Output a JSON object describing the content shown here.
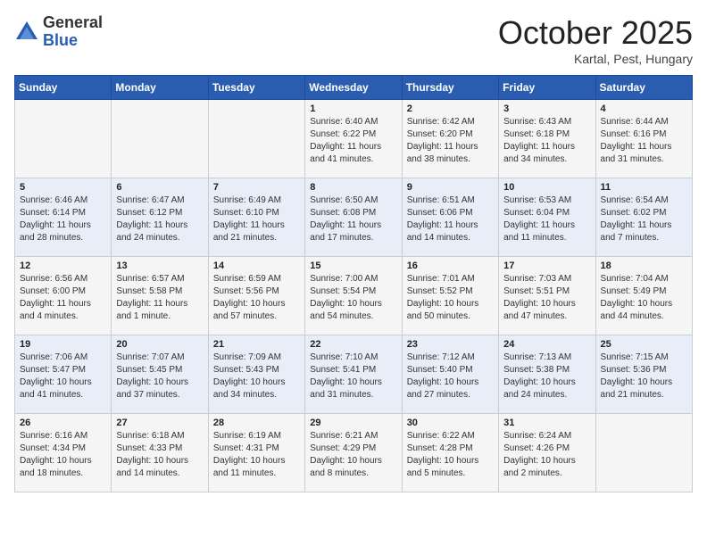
{
  "header": {
    "logo": {
      "general": "General",
      "blue": "Blue"
    },
    "title": "October 2025",
    "location": "Kartal, Pest, Hungary"
  },
  "days_of_week": [
    "Sunday",
    "Monday",
    "Tuesday",
    "Wednesday",
    "Thursday",
    "Friday",
    "Saturday"
  ],
  "weeks": [
    [
      {
        "day": "",
        "info": ""
      },
      {
        "day": "",
        "info": ""
      },
      {
        "day": "",
        "info": ""
      },
      {
        "day": "1",
        "info": "Sunrise: 6:40 AM\nSunset: 6:22 PM\nDaylight: 11 hours\nand 41 minutes."
      },
      {
        "day": "2",
        "info": "Sunrise: 6:42 AM\nSunset: 6:20 PM\nDaylight: 11 hours\nand 38 minutes."
      },
      {
        "day": "3",
        "info": "Sunrise: 6:43 AM\nSunset: 6:18 PM\nDaylight: 11 hours\nand 34 minutes."
      },
      {
        "day": "4",
        "info": "Sunrise: 6:44 AM\nSunset: 6:16 PM\nDaylight: 11 hours\nand 31 minutes."
      }
    ],
    [
      {
        "day": "5",
        "info": "Sunrise: 6:46 AM\nSunset: 6:14 PM\nDaylight: 11 hours\nand 28 minutes."
      },
      {
        "day": "6",
        "info": "Sunrise: 6:47 AM\nSunset: 6:12 PM\nDaylight: 11 hours\nand 24 minutes."
      },
      {
        "day": "7",
        "info": "Sunrise: 6:49 AM\nSunset: 6:10 PM\nDaylight: 11 hours\nand 21 minutes."
      },
      {
        "day": "8",
        "info": "Sunrise: 6:50 AM\nSunset: 6:08 PM\nDaylight: 11 hours\nand 17 minutes."
      },
      {
        "day": "9",
        "info": "Sunrise: 6:51 AM\nSunset: 6:06 PM\nDaylight: 11 hours\nand 14 minutes."
      },
      {
        "day": "10",
        "info": "Sunrise: 6:53 AM\nSunset: 6:04 PM\nDaylight: 11 hours\nand 11 minutes."
      },
      {
        "day": "11",
        "info": "Sunrise: 6:54 AM\nSunset: 6:02 PM\nDaylight: 11 hours\nand 7 minutes."
      }
    ],
    [
      {
        "day": "12",
        "info": "Sunrise: 6:56 AM\nSunset: 6:00 PM\nDaylight: 11 hours\nand 4 minutes."
      },
      {
        "day": "13",
        "info": "Sunrise: 6:57 AM\nSunset: 5:58 PM\nDaylight: 11 hours\nand 1 minute."
      },
      {
        "day": "14",
        "info": "Sunrise: 6:59 AM\nSunset: 5:56 PM\nDaylight: 10 hours\nand 57 minutes."
      },
      {
        "day": "15",
        "info": "Sunrise: 7:00 AM\nSunset: 5:54 PM\nDaylight: 10 hours\nand 54 minutes."
      },
      {
        "day": "16",
        "info": "Sunrise: 7:01 AM\nSunset: 5:52 PM\nDaylight: 10 hours\nand 50 minutes."
      },
      {
        "day": "17",
        "info": "Sunrise: 7:03 AM\nSunset: 5:51 PM\nDaylight: 10 hours\nand 47 minutes."
      },
      {
        "day": "18",
        "info": "Sunrise: 7:04 AM\nSunset: 5:49 PM\nDaylight: 10 hours\nand 44 minutes."
      }
    ],
    [
      {
        "day": "19",
        "info": "Sunrise: 7:06 AM\nSunset: 5:47 PM\nDaylight: 10 hours\nand 41 minutes."
      },
      {
        "day": "20",
        "info": "Sunrise: 7:07 AM\nSunset: 5:45 PM\nDaylight: 10 hours\nand 37 minutes."
      },
      {
        "day": "21",
        "info": "Sunrise: 7:09 AM\nSunset: 5:43 PM\nDaylight: 10 hours\nand 34 minutes."
      },
      {
        "day": "22",
        "info": "Sunrise: 7:10 AM\nSunset: 5:41 PM\nDaylight: 10 hours\nand 31 minutes."
      },
      {
        "day": "23",
        "info": "Sunrise: 7:12 AM\nSunset: 5:40 PM\nDaylight: 10 hours\nand 27 minutes."
      },
      {
        "day": "24",
        "info": "Sunrise: 7:13 AM\nSunset: 5:38 PM\nDaylight: 10 hours\nand 24 minutes."
      },
      {
        "day": "25",
        "info": "Sunrise: 7:15 AM\nSunset: 5:36 PM\nDaylight: 10 hours\nand 21 minutes."
      }
    ],
    [
      {
        "day": "26",
        "info": "Sunrise: 6:16 AM\nSunset: 4:34 PM\nDaylight: 10 hours\nand 18 minutes."
      },
      {
        "day": "27",
        "info": "Sunrise: 6:18 AM\nSunset: 4:33 PM\nDaylight: 10 hours\nand 14 minutes."
      },
      {
        "day": "28",
        "info": "Sunrise: 6:19 AM\nSunset: 4:31 PM\nDaylight: 10 hours\nand 11 minutes."
      },
      {
        "day": "29",
        "info": "Sunrise: 6:21 AM\nSunset: 4:29 PM\nDaylight: 10 hours\nand 8 minutes."
      },
      {
        "day": "30",
        "info": "Sunrise: 6:22 AM\nSunset: 4:28 PM\nDaylight: 10 hours\nand 5 minutes."
      },
      {
        "day": "31",
        "info": "Sunrise: 6:24 AM\nSunset: 4:26 PM\nDaylight: 10 hours\nand 2 minutes."
      },
      {
        "day": "",
        "info": ""
      }
    ]
  ]
}
